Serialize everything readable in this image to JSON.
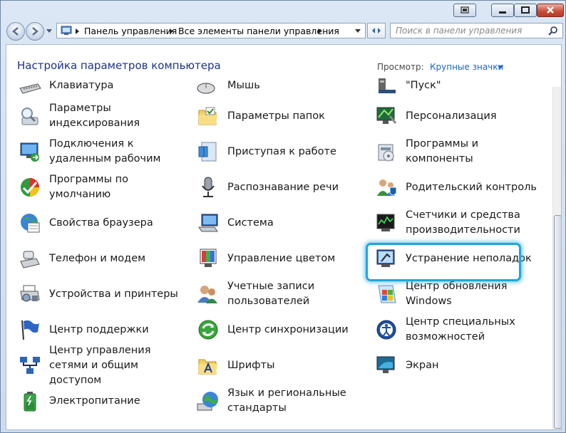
{
  "window": {
    "caption_buttons": [
      "minimize-icon",
      "maximize-icon",
      "close-icon"
    ]
  },
  "nav": {
    "breadcrumbs": [
      "Панель управления",
      "Все элементы панели управления"
    ],
    "search_placeholder": "Поиск в панели управления"
  },
  "header": {
    "title": "Настройка параметров компьютера",
    "view_label": "Просмотр:",
    "view_value": "Крупные значки"
  },
  "items": [
    {
      "label": "Клавиатура",
      "icon": "keyboard-icon"
    },
    {
      "label": "Мышь",
      "icon": "mouse-icon"
    },
    {
      "label": "\"Пуск\"",
      "icon": "taskbar-icon"
    },
    {
      "label": "Параметры индексирования",
      "icon": "indexing-icon"
    },
    {
      "label": "Параметры папок",
      "icon": "folder-options-icon"
    },
    {
      "label": "Персонализация",
      "icon": "personalization-icon"
    },
    {
      "label": "Подключения к удаленным рабочим",
      "icon": "remote-desktop-icon"
    },
    {
      "label": "Приступая к работе",
      "icon": "getting-started-icon"
    },
    {
      "label": "Программы и компоненты",
      "icon": "programs-icon"
    },
    {
      "label": "Программы по умолчанию",
      "icon": "default-programs-icon"
    },
    {
      "label": "Распознавание речи",
      "icon": "microphone-icon"
    },
    {
      "label": "Родительский контроль",
      "icon": "parental-controls-icon"
    },
    {
      "label": "Свойства браузера",
      "icon": "internet-options-icon"
    },
    {
      "label": "Система",
      "icon": "system-icon"
    },
    {
      "label": "Счетчики и средства производительности",
      "icon": "performance-icon"
    },
    {
      "label": "Телефон и модем",
      "icon": "phone-modem-icon"
    },
    {
      "label": "Управление цветом",
      "icon": "color-management-icon"
    },
    {
      "label": "Устранение неполадок",
      "icon": "troubleshooting-icon"
    },
    {
      "label": "Устройства и принтеры",
      "icon": "devices-printers-icon"
    },
    {
      "label": "Учетные записи пользователей",
      "icon": "user-accounts-icon"
    },
    {
      "label": "Центр обновления Windows",
      "icon": "windows-update-icon"
    },
    {
      "label": "Центр поддержки",
      "icon": "action-center-flag-icon"
    },
    {
      "label": "Центр синхронизации",
      "icon": "sync-center-icon"
    },
    {
      "label": "Центр специальных возможностей",
      "icon": "ease-of-access-icon"
    },
    {
      "label": "Центр управления сетями и общим доступом",
      "icon": "network-center-icon"
    },
    {
      "label": "Шрифты",
      "icon": "fonts-icon"
    },
    {
      "label": "Экран",
      "icon": "display-icon"
    },
    {
      "label": "Электропитание",
      "icon": "power-options-icon"
    },
    {
      "label": "Язык и региональные стандарты",
      "icon": "region-language-icon"
    }
  ],
  "highlighted_item": "Центр обновления Windows",
  "colors": {
    "heading": "#1e3287",
    "link": "#1e64c8",
    "highlight": "#1aa8e0"
  }
}
